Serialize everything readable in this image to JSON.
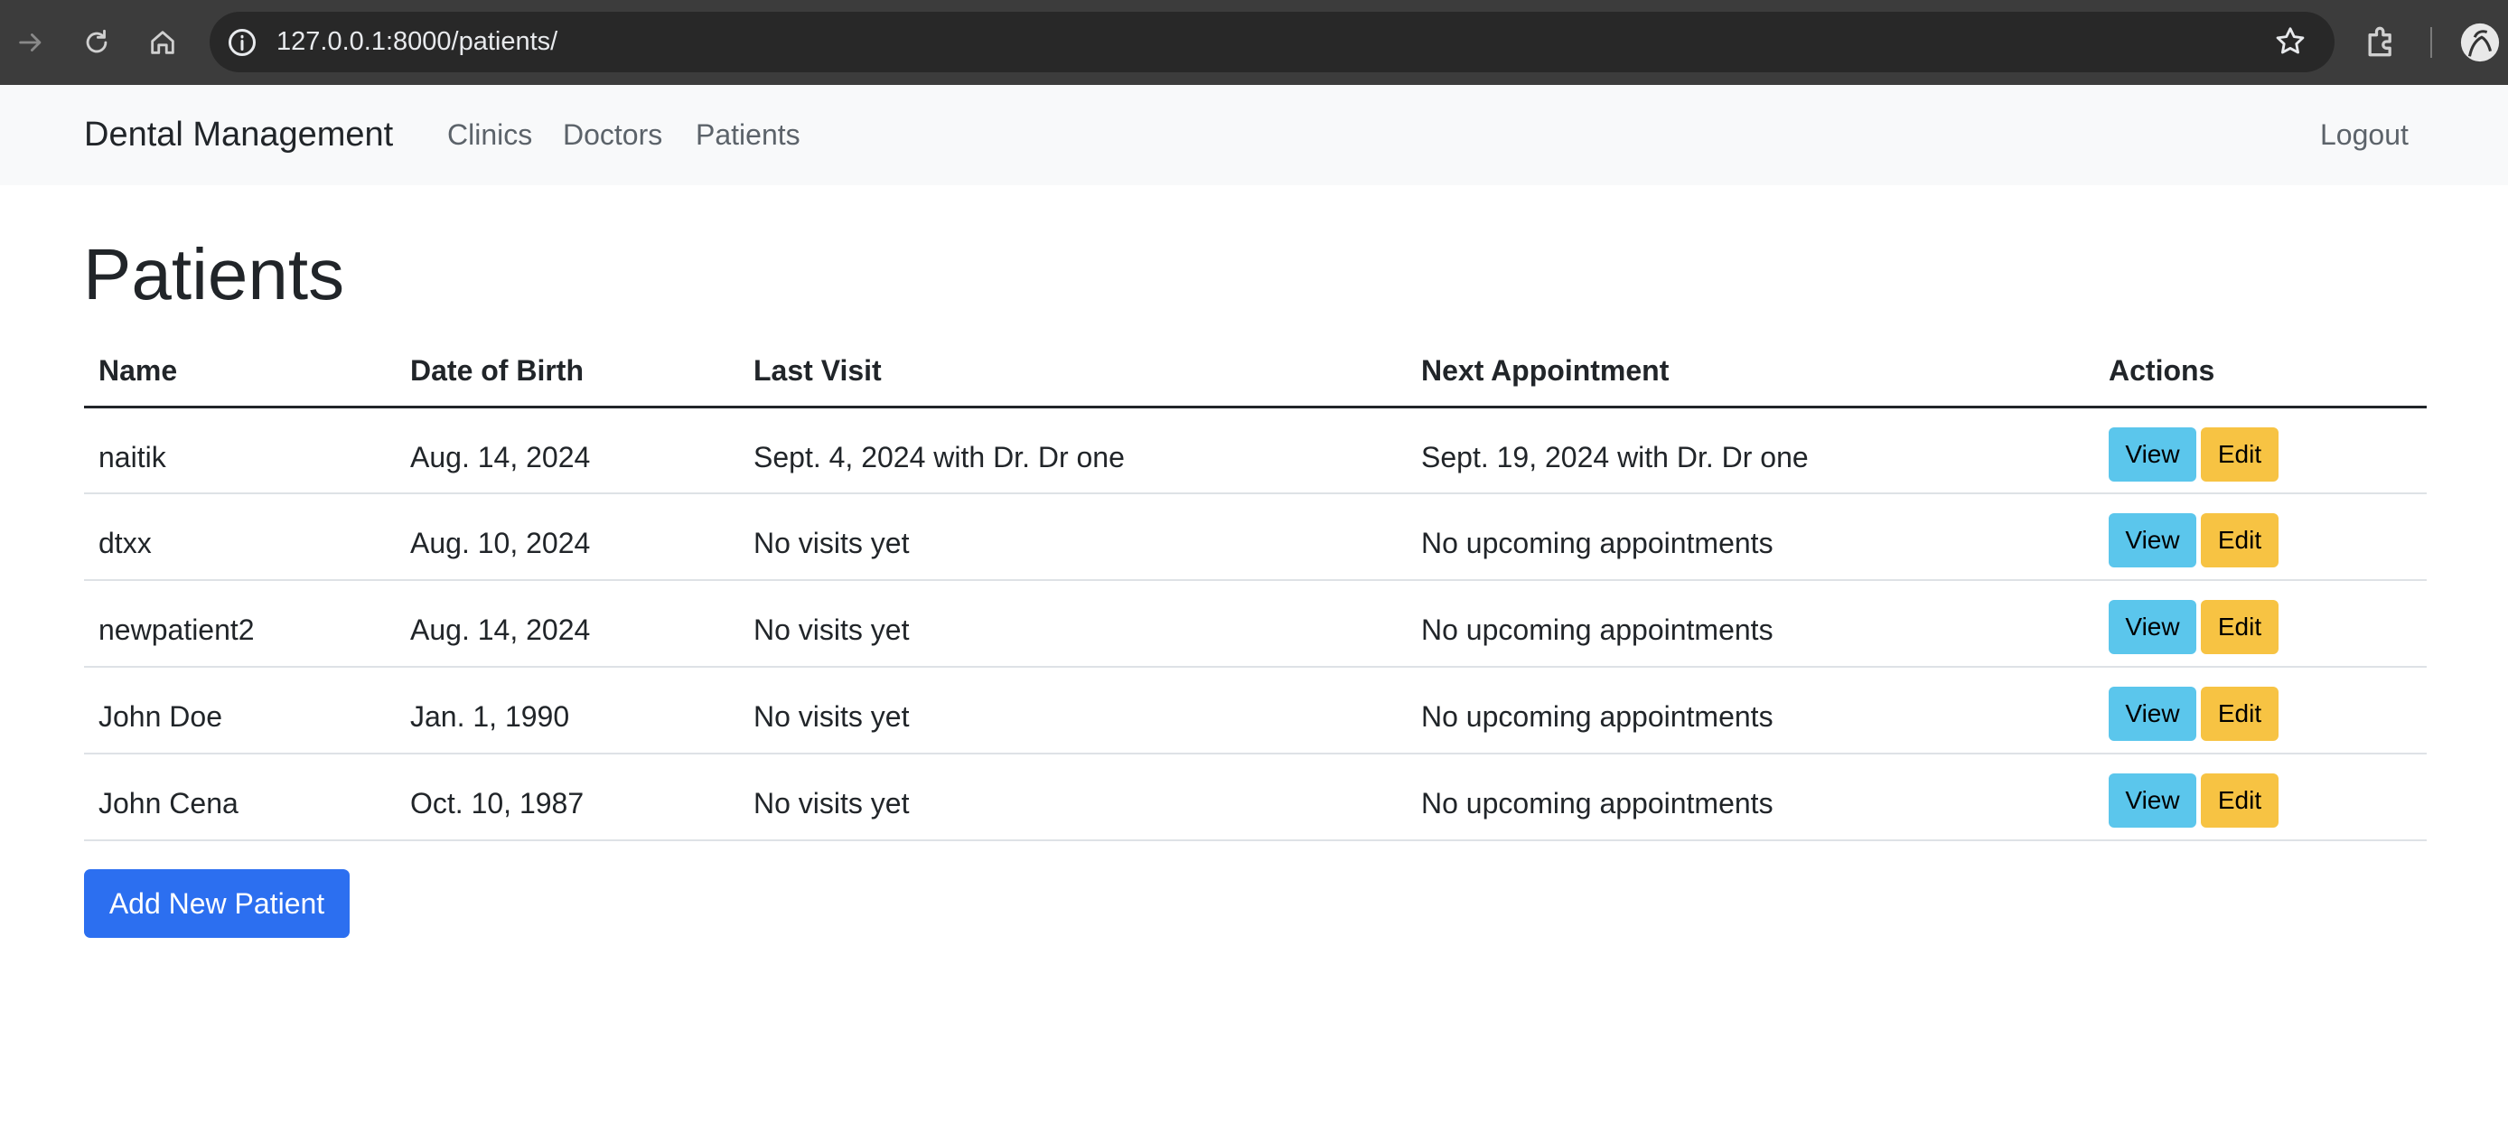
{
  "browser": {
    "url": "127.0.0.1:8000/patients/",
    "icons": [
      "forward-icon",
      "reload-icon",
      "home-icon",
      "site-info-icon",
      "bookmark-star-icon",
      "extensions-icon",
      "profile-icon"
    ]
  },
  "navbar": {
    "brand": "Dental Management",
    "links": [
      {
        "label": "Clinics"
      },
      {
        "label": "Doctors"
      },
      {
        "label": "Patients"
      }
    ],
    "logout": "Logout"
  },
  "page": {
    "title": "Patients",
    "add_button": "Add New Patient"
  },
  "table": {
    "headers": [
      "Name",
      "Date of Birth",
      "Last Visit",
      "Next Appointment",
      "Actions"
    ],
    "rows": [
      {
        "name": "naitik",
        "dob": "Aug. 14, 2024",
        "last_visit": "Sept. 4, 2024 with Dr. Dr one",
        "next_appointment": "Sept. 19, 2024 with Dr. Dr one",
        "view": "View",
        "edit": "Edit"
      },
      {
        "name": "dtxx",
        "dob": "Aug. 10, 2024",
        "last_visit": "No visits yet",
        "next_appointment": "No upcoming appointments",
        "view": "View",
        "edit": "Edit"
      },
      {
        "name": "newpatient2",
        "dob": "Aug. 14, 2024",
        "last_visit": "No visits yet",
        "next_appointment": "No upcoming appointments",
        "view": "View",
        "edit": "Edit"
      },
      {
        "name": "John Doe",
        "dob": "Jan. 1, 1990",
        "last_visit": "No visits yet",
        "next_appointment": "No upcoming appointments",
        "view": "View",
        "edit": "Edit"
      },
      {
        "name": "John Cena",
        "dob": "Oct. 10, 1987",
        "last_visit": "No visits yet",
        "next_appointment": "No upcoming appointments",
        "view": "View",
        "edit": "Edit"
      }
    ]
  },
  "colors": {
    "chrome_bg": "#3c3c3c",
    "navbar_bg": "#f8f9fa",
    "view_button": "#5bc6ec",
    "edit_button": "#f7c343",
    "primary_button": "#2c6ff0"
  }
}
